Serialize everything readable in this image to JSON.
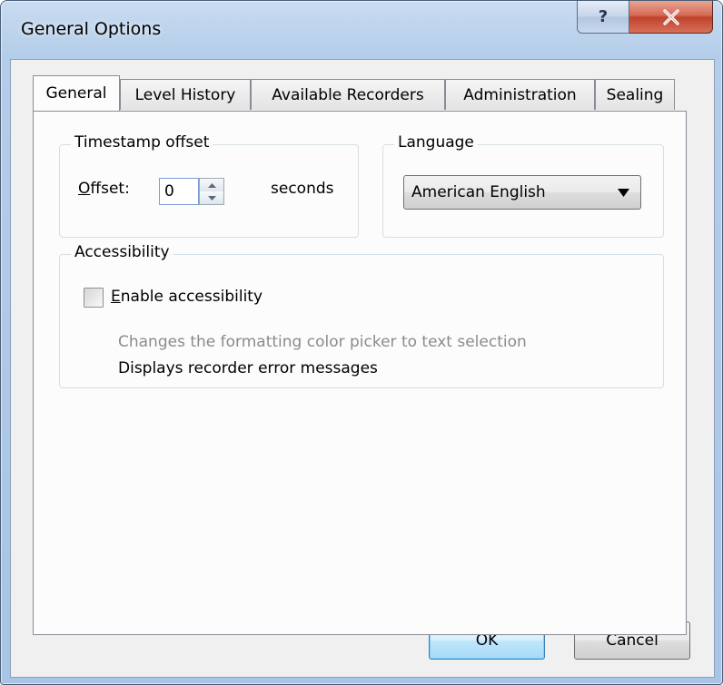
{
  "window": {
    "title": "General Options",
    "help_glyph": "?",
    "close_glyph": "x"
  },
  "tabs": [
    {
      "label": "General",
      "active": true
    },
    {
      "label": "Level History",
      "active": false
    },
    {
      "label": "Available Recorders",
      "active": false
    },
    {
      "label": "Administration",
      "active": false
    },
    {
      "label": "Sealing",
      "active": false
    }
  ],
  "timestamp": {
    "group_label": "Timestamp offset",
    "offset_label_rest": "ffset:",
    "offset_label_underlined": "O",
    "offset_value": "0",
    "unit": "seconds"
  },
  "language": {
    "group_label": "Language",
    "selected": "American English"
  },
  "accessibility": {
    "group_label": "Accessibility",
    "checkbox_underlined": "E",
    "checkbox_label_rest": "nable accessibility",
    "checked": false,
    "description_disabled": "Changes the formatting color picker to text selection",
    "description_enabled": "Displays recorder error messages"
  },
  "buttons": {
    "ok": "OK",
    "cancel": "Cancel"
  },
  "colors": {
    "title_bar": "#b4cde9",
    "close_button": "#c0422b",
    "default_button_border": "#3c7fb1",
    "disabled_text": "#8b8b8b"
  }
}
